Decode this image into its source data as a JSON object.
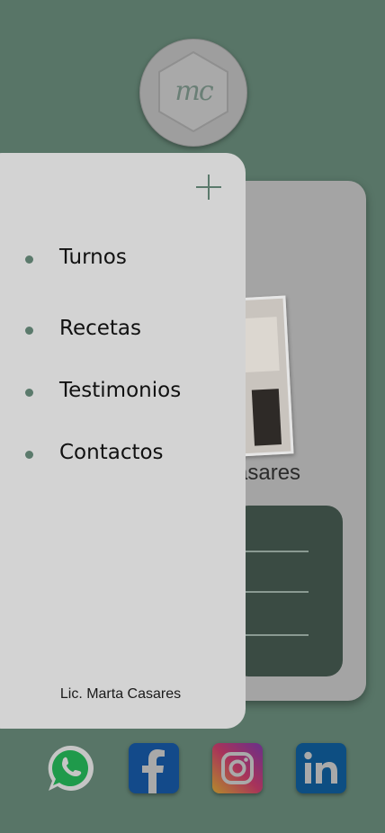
{
  "logo": {
    "monogram": "mc"
  },
  "background_card": {
    "name_fragment": "asares"
  },
  "menu": {
    "items": [
      {
        "label": "Turnos"
      },
      {
        "label": "Recetas"
      },
      {
        "label": "Testimonios"
      },
      {
        "label": "Contactos"
      }
    ]
  },
  "footer": {
    "name": "Lic. Marta Casares"
  },
  "social": [
    {
      "icon": "whatsapp-icon",
      "color": "#25D366"
    },
    {
      "icon": "facebook-icon",
      "color": "#1877F2"
    },
    {
      "icon": "instagram-icon",
      "color": "#E1306C"
    },
    {
      "icon": "linkedin-icon",
      "color": "#0A66C2"
    }
  ],
  "colors": {
    "page_background": "#587567",
    "drawer_background": "#d3d3d3",
    "accent": "#5b7a6c"
  }
}
